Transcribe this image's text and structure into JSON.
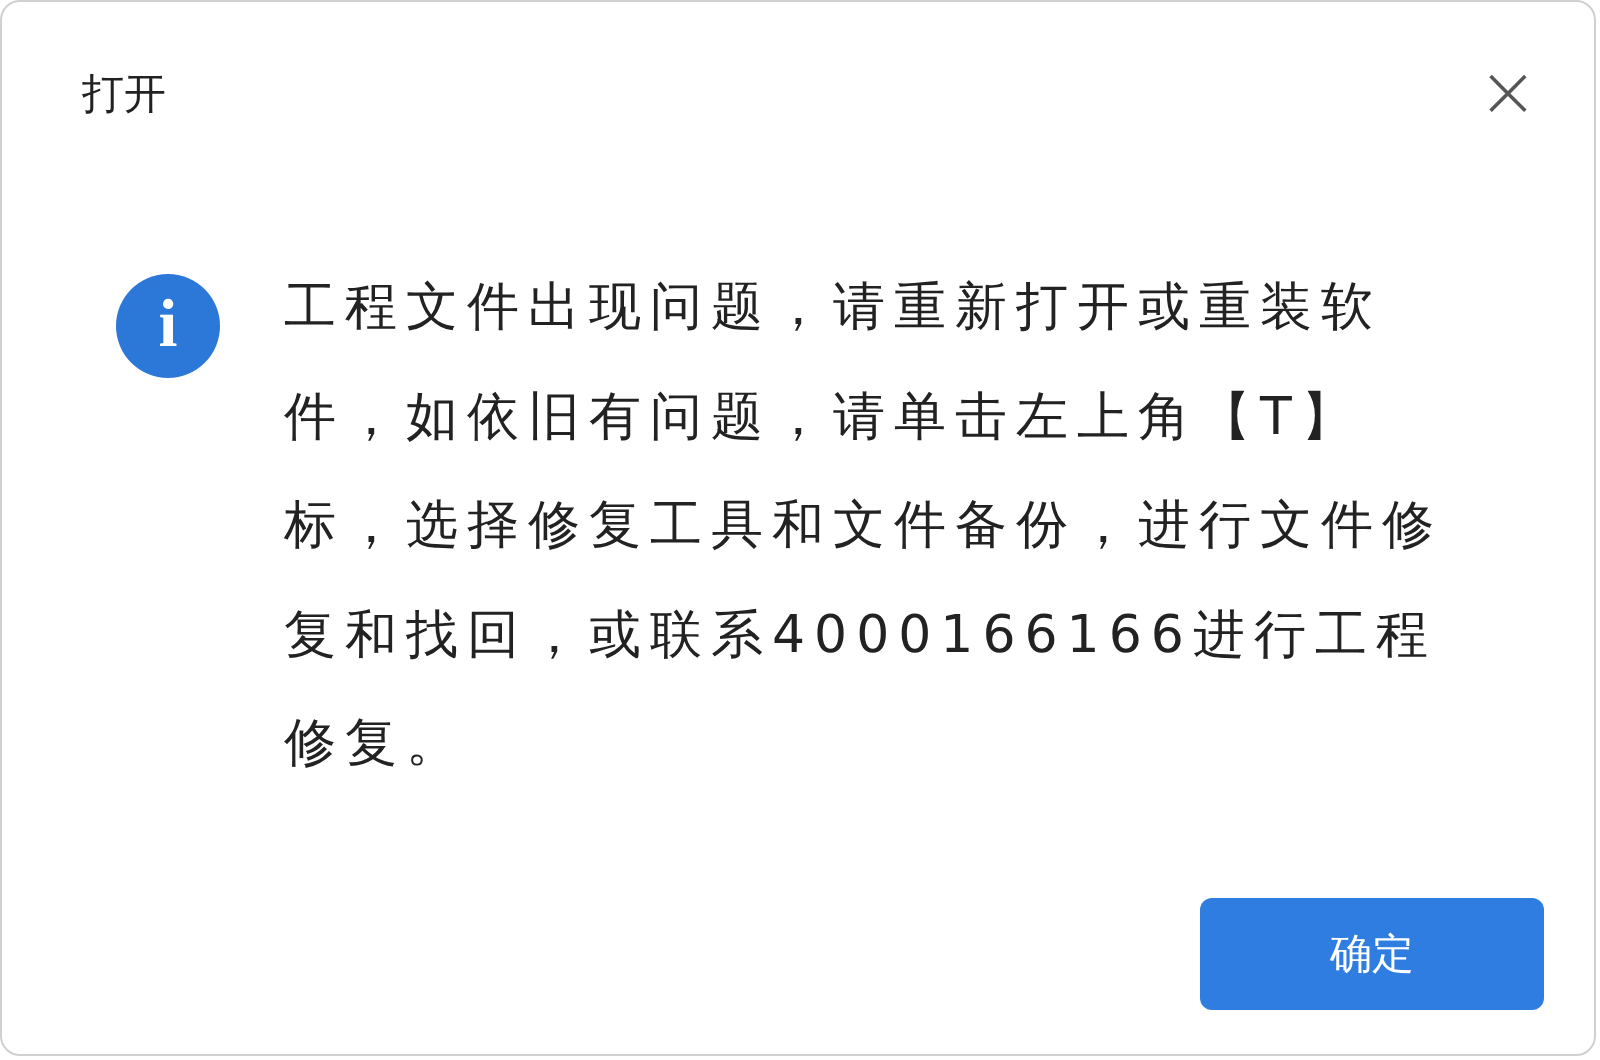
{
  "dialog": {
    "title": "打开",
    "close": "×",
    "message": "工程文件出现问题，请重新打开或重装软件，如依旧有问题，请单击左上角【T】标，选择修复工具和文件备份，进行文件修复和找回，或联系4000166166进行工程修复。",
    "icon": "i",
    "buttons": [
      "确定"
    ]
  }
}
